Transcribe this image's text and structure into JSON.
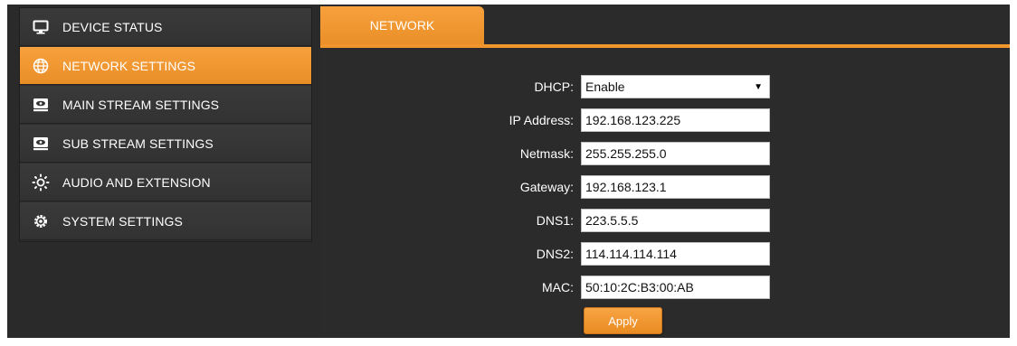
{
  "sidebar": {
    "items": [
      {
        "label": "DEVICE STATUS",
        "icon": "monitor-icon",
        "active": false
      },
      {
        "label": "NETWORK SETTINGS",
        "icon": "globe-icon",
        "active": true
      },
      {
        "label": "MAIN STREAM SETTINGS",
        "icon": "video-stream-icon",
        "active": false
      },
      {
        "label": "SUB STREAM SETTINGS",
        "icon": "video-stream-icon",
        "active": false
      },
      {
        "label": "AUDIO AND EXTENSION",
        "icon": "sun-icon",
        "active": false
      },
      {
        "label": "SYSTEM SETTINGS",
        "icon": "gear-icon",
        "active": false
      }
    ]
  },
  "tab": {
    "label": "NETWORK"
  },
  "form": {
    "dhcp": {
      "label": "DHCP:",
      "value": "Enable"
    },
    "ip": {
      "label": "IP Address:",
      "value": "192.168.123.225"
    },
    "netmask": {
      "label": "Netmask:",
      "value": "255.255.255.0"
    },
    "gateway": {
      "label": "Gateway:",
      "value": "192.168.123.1"
    },
    "dns1": {
      "label": "DNS1:",
      "value": "223.5.5.5"
    },
    "dns2": {
      "label": "DNS2:",
      "value": "114.114.114.114"
    },
    "mac": {
      "label": "MAC:",
      "value": "50:10:2C:B3:00:AB"
    },
    "apply_label": "Apply"
  },
  "colors": {
    "accent": "#f0962c",
    "background": "#2a2a2a",
    "sidebar_item": "#363636"
  }
}
